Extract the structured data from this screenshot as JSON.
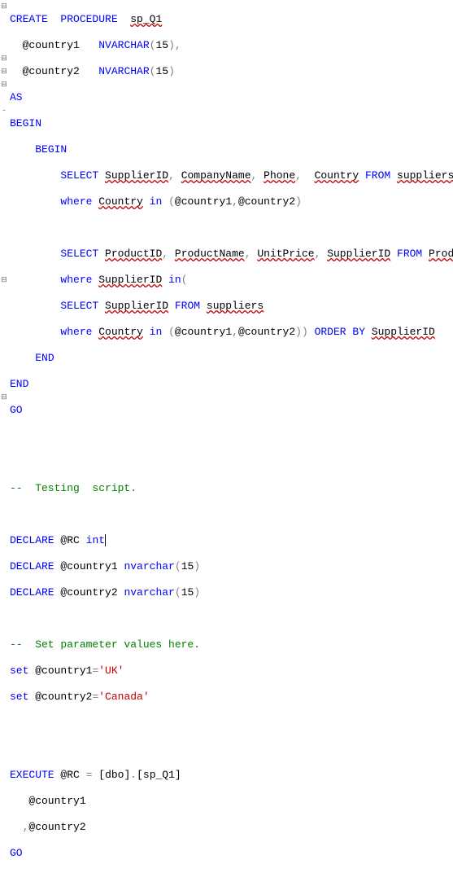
{
  "gutter": [
    "⊟",
    "",
    "",
    "",
    "⊟",
    "⊟",
    "⊟",
    "",
    "-",
    "",
    "",
    "",
    "",
    "",
    "",
    "",
    "",
    "",
    "",
    "",
    "",
    "⊟",
    "",
    "",
    "",
    "",
    "",
    "",
    "",
    "",
    "⊟",
    "",
    "",
    ""
  ],
  "line1": {
    "a": "CREATE",
    "b": "PROCEDURE",
    "c": "sp_Q1"
  },
  "line2": {
    "a": "@country1",
    "b": "NVARCHAR",
    "c": "(",
    "d": "15",
    "e": "),"
  },
  "line3": {
    "a": "@country2",
    "b": "NVARCHAR",
    "c": "(",
    "d": "15",
    "e": ")"
  },
  "line4": {
    "a": "AS"
  },
  "line5": {
    "a": "BEGIN"
  },
  "line6": {
    "a": "BEGIN"
  },
  "line7": {
    "a": "SELECT",
    "b": "SupplierID",
    "c": ",",
    "d": "CompanyName",
    "e": ",",
    "f": "Phone",
    "g": ",",
    "h": "Country",
    "i": "FROM",
    "j": "suppliers"
  },
  "line8": {
    "a": "where",
    "b": "Country",
    "c": "in",
    "d": "(",
    "e": "@country1",
    "f": ",",
    "g": "@country2",
    "h": ")"
  },
  "line10": {
    "a": "SELECT",
    "b": "ProductID",
    "c": ",",
    "d": "ProductName",
    "e": ",",
    "f": "UnitPrice",
    "g": ",",
    "h": "SupplierID",
    "i": "FROM",
    "j": "Products"
  },
  "line11": {
    "a": "where",
    "b": "SupplierID",
    "c": "in",
    "d": "("
  },
  "line12": {
    "a": "SELECT",
    "b": "SupplierID",
    "c": "FROM",
    "d": "suppliers"
  },
  "line13": {
    "a": "where",
    "b": "Country",
    "c": "in",
    "d": "(",
    "e": "@country1",
    "f": ",",
    "g": "@country2",
    "h": "))",
    "i": "ORDER",
    "j": "BY",
    "k": "SupplierID"
  },
  "line14": {
    "a": "END"
  },
  "line15": {
    "a": "END"
  },
  "line16": {
    "a": "GO"
  },
  "line19": {
    "a": "--  Testing  script."
  },
  "line21": {
    "a": "DECLARE",
    "b": "@RC",
    "c": "int"
  },
  "line22": {
    "a": "DECLARE",
    "b": "@country1",
    "c": "nvarchar",
    "d": "(",
    "e": "15",
    "f": ")"
  },
  "line23": {
    "a": "DECLARE",
    "b": "@country2",
    "c": "nvarchar",
    "d": "(",
    "e": "15",
    "f": ")"
  },
  "line25": {
    "a": "--  Set parameter values here."
  },
  "line26": {
    "a": "set",
    "b": "@country1",
    "c": "=",
    "d": "'UK'"
  },
  "line27": {
    "a": "set",
    "b": "@country2",
    "c": "=",
    "d": "'Canada'"
  },
  "line30": {
    "a": "EXECUTE",
    "b": "@RC",
    "c": "=",
    "d": "[dbo]",
    "e": ".",
    "f": "[sp_Q1]"
  },
  "line31": {
    "a": "@country1"
  },
  "line32": {
    "a": ",",
    "b": "@country2"
  },
  "line33": {
    "a": "GO"
  }
}
